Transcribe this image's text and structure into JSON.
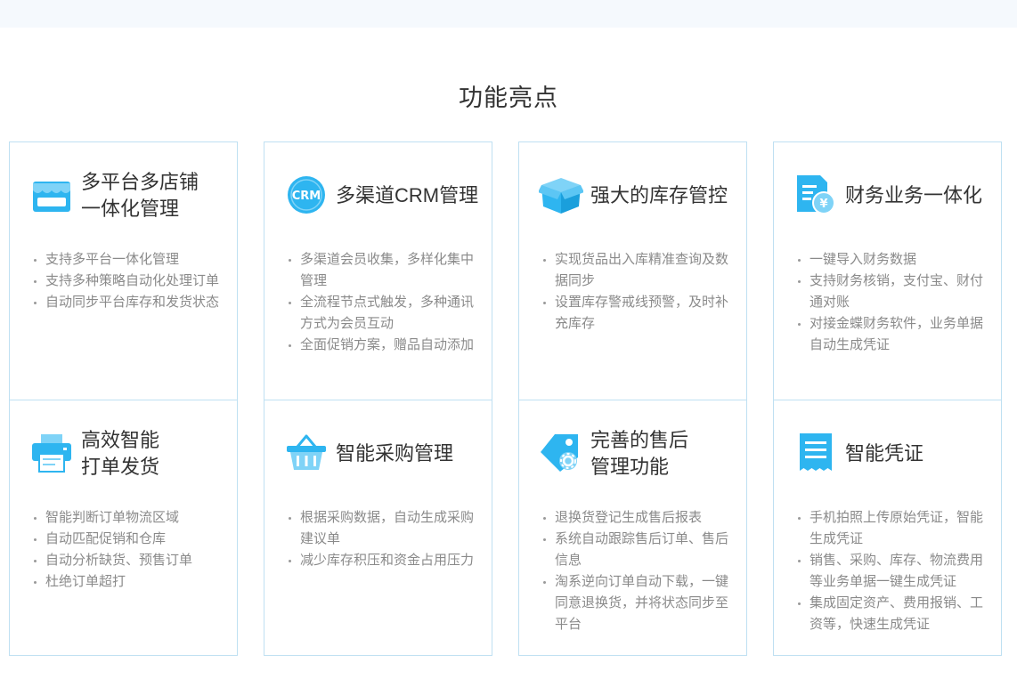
{
  "section": {
    "title": "功能亮点"
  },
  "colors": {
    "accent": "#2eb5f0",
    "border": "#bfe0f2",
    "text": "#333333",
    "muted": "#8a8a8a"
  },
  "cards": [
    {
      "icon": "store-icon",
      "title": "多平台多店铺\n一体化管理",
      "items": [
        "支持多平台一体化管理",
        "支持多种策略自动化处理订单",
        "自动同步平台库存和发货状态"
      ]
    },
    {
      "icon": "printer-icon",
      "title": "高效智能\n打单发货",
      "items": [
        "智能判断订单物流区域",
        "自动匹配促销和仓库",
        "自动分析缺货、预售订单",
        "杜绝订单超打"
      ]
    },
    {
      "icon": "crm-icon",
      "title": "多渠道CRM管理",
      "items": [
        "多渠道会员收集，多样化集中管理",
        "全流程节点式触发，多种通讯方式为会员互动",
        "全面促销方案，赠品自动添加"
      ]
    },
    {
      "icon": "basket-icon",
      "title": "智能采购管理",
      "items": [
        "根据采购数据，自动生成采购建议单",
        "减少库存积压和资金占用压力"
      ]
    },
    {
      "icon": "box-icon",
      "title": "强大的库存管控",
      "items": [
        "实现货品出入库精准查询及数据同步",
        "设置库存警戒线预警，及时补充库存"
      ]
    },
    {
      "icon": "tag-gear-icon",
      "title": "完善的售后\n管理功能",
      "items": [
        "退换货登记生成售后报表",
        "系统自动跟踪售后订单、售后信息",
        "淘系逆向订单自动下载，一键同意退换货，并将状态同步至平台"
      ]
    },
    {
      "icon": "finance-doc-icon",
      "title": "财务业务一体化",
      "items": [
        "一键导入财务数据",
        "支持财务核销，支付宝、财付通对账",
        "对接金蝶财务软件，业务单据自动生成凭证"
      ]
    },
    {
      "icon": "voucher-icon",
      "title": "智能凭证",
      "items": [
        "手机拍照上传原始凭证，智能生成凭证",
        "销售、采购、库存、物流费用等业务单据一键生成凭证",
        "集成固定资产、费用报销、工资等，快速生成凭证"
      ]
    }
  ]
}
